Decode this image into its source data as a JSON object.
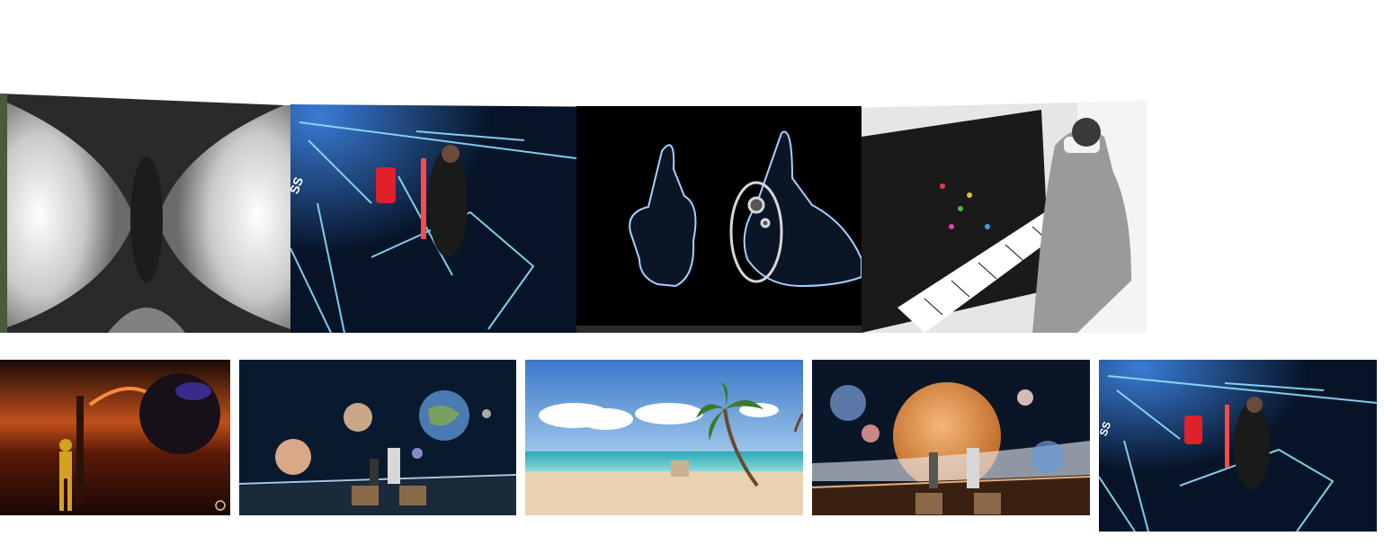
{
  "carousel_top": {
    "items": [
      {
        "name": "tunnel-vr-clip",
        "icon": "vr-tunnel-image"
      },
      {
        "name": "beat-saber-clip",
        "icon": "beat-saber-image"
      },
      {
        "name": "thumbs-up-hands-clip",
        "icon": "vr-hands-controller-image"
      },
      {
        "name": "piano-vr-clip",
        "icon": "piano-player-vr-image"
      }
    ]
  },
  "thumbnails_bottom": {
    "items": [
      {
        "name": "orange-astronaut-clip",
        "icon": "astronaut-room-image"
      },
      {
        "name": "planets-deck-clip",
        "icon": "planets-balcony-image"
      },
      {
        "name": "beach-clip",
        "icon": "tropical-beach-image"
      },
      {
        "name": "orange-planet-clip",
        "icon": "large-planet-balcony-image"
      },
      {
        "name": "beat-saber-clip-2",
        "icon": "beat-saber-image"
      }
    ]
  },
  "colors": {
    "background": "#ffffff",
    "neon_blue": "#7fd6ff",
    "saber_red": "#e0202a",
    "sky_blue": "#4a8fd8",
    "sand": "#e8d2b0",
    "sun_orange": "#e6a060"
  }
}
